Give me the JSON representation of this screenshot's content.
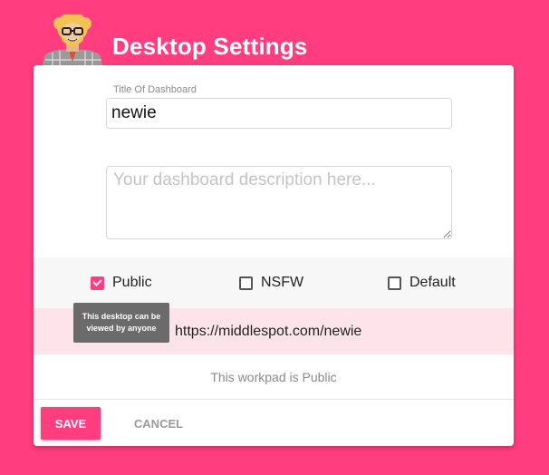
{
  "header": {
    "title": "Desktop Settings",
    "avatar_icon": "cartoon-bearded-man-avatar",
    "background_color": "#ff3d7f"
  },
  "form": {
    "title_label": "Title Of Dashboard",
    "title_value": "newie",
    "description_value": "",
    "description_placeholder": "Your dashboard description here..."
  },
  "options": [
    {
      "label": "Public",
      "checked": true
    },
    {
      "label": "NSFW",
      "checked": false
    },
    {
      "label": "Default",
      "checked": false
    }
  ],
  "url": "https://middlespot.com/newie",
  "tooltip": "This desktop can be viewed by anyone",
  "status": "This workpad is Public",
  "actions": {
    "save_label": "SAVE",
    "cancel_label": "CANCEL"
  },
  "colors": {
    "accent": "#ff3d7f",
    "url_row_bg": "#fde4eb"
  }
}
